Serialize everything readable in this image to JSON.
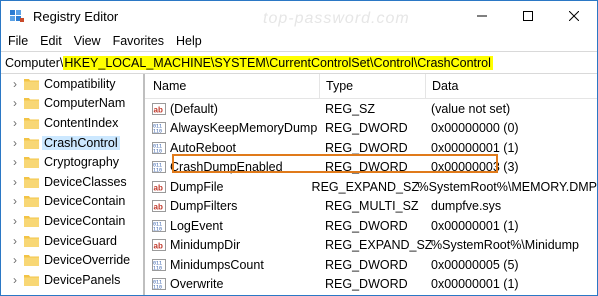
{
  "window": {
    "title": "Registry Editor",
    "watermark": "top-password.com"
  },
  "menu": [
    "File",
    "Edit",
    "View",
    "Favorites",
    "Help"
  ],
  "address": {
    "prefix": "Computer\\",
    "path": "HKEY_LOCAL_MACHINE\\SYSTEM\\CurrentControlSet\\Control\\CrashControl"
  },
  "tree": [
    {
      "label": "Compatibility",
      "selected": false
    },
    {
      "label": "ComputerNam",
      "selected": false
    },
    {
      "label": "ContentIndex",
      "selected": false
    },
    {
      "label": "CrashControl",
      "selected": true
    },
    {
      "label": "Cryptography",
      "selected": false
    },
    {
      "label": "DeviceClasses",
      "selected": false
    },
    {
      "label": "DeviceContain",
      "selected": false
    },
    {
      "label": "DeviceContain",
      "selected": false
    },
    {
      "label": "DeviceGuard",
      "selected": false
    },
    {
      "label": "DeviceOverride",
      "selected": false
    },
    {
      "label": "DevicePanels",
      "selected": false
    }
  ],
  "columns": {
    "name": "Name",
    "type": "Type",
    "data": "Data"
  },
  "values": [
    {
      "icon": "string-value-icon",
      "name": "(Default)",
      "type": "REG_SZ",
      "data": "(value not set)"
    },
    {
      "icon": "binary-value-icon",
      "name": "AlwaysKeepMemoryDump",
      "type": "REG_DWORD",
      "data": "0x00000000 (0)"
    },
    {
      "icon": "binary-value-icon",
      "name": "AutoReboot",
      "type": "REG_DWORD",
      "data": "0x00000001 (1)"
    },
    {
      "icon": "binary-value-icon",
      "name": "CrashDumpEnabled",
      "type": "REG_DWORD",
      "data": "0x00000003 (3)",
      "highlighted": true
    },
    {
      "icon": "string-value-icon",
      "name": "DumpFile",
      "type": "REG_EXPAND_SZ",
      "data": "%SystemRoot%\\MEMORY.DMP"
    },
    {
      "icon": "string-value-icon",
      "name": "DumpFilters",
      "type": "REG_MULTI_SZ",
      "data": "dumpfve.sys"
    },
    {
      "icon": "binary-value-icon",
      "name": "LogEvent",
      "type": "REG_DWORD",
      "data": "0x00000001 (1)"
    },
    {
      "icon": "string-value-icon",
      "name": "MinidumpDir",
      "type": "REG_EXPAND_SZ",
      "data": "%SystemRoot%\\Minidump"
    },
    {
      "icon": "binary-value-icon",
      "name": "MinidumpsCount",
      "type": "REG_DWORD",
      "data": "0x00000005 (5)"
    },
    {
      "icon": "binary-value-icon",
      "name": "Overwrite",
      "type": "REG_DWORD",
      "data": "0x00000001 (1)"
    }
  ],
  "colors": {
    "address_highlight": "#ffff00",
    "annotation_box": "#e07a1a",
    "tree_selection": "#cce8ff",
    "folder": "#f3c446"
  }
}
